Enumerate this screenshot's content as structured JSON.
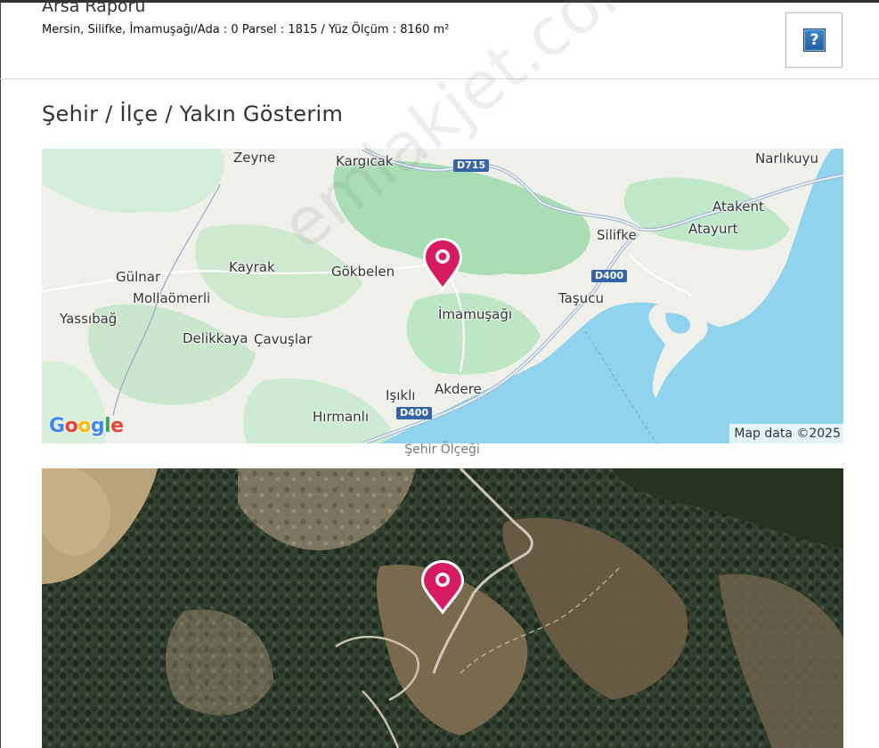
{
  "header": {
    "title": "Arsa Raporu",
    "subtitle": "Mersin, Silifke, İmamuşağı/Ada : 0 Parsel : 1815 / Yüz Ölçüm : 8160 m²",
    "help_label": "?"
  },
  "section": {
    "title": "Şehir / İlçe / Yakın Gösterim"
  },
  "road_map": {
    "places": {
      "zeyne": "Zeyne",
      "kargicak": "Kargıcak",
      "narlikuyu": "Narlıkuyu",
      "atakent": "Atakent",
      "atayurt": "Atayurt",
      "silifke": "Silifke",
      "gulnar": "Gülnar",
      "kayrak": "Kayrak",
      "gokbelen": "Gökbelen",
      "mollaomerli": "Mollaömerli",
      "yassibag": "Yassıbağ",
      "imamusagi": "İmamuşağı",
      "tasucu": "Taşucu",
      "delikkaya": "Delikkaya",
      "cavuslar": "Çavuşlar",
      "akdere": "Akdere",
      "isikli": "Işıklı",
      "hirmanli": "Hırmanlı"
    },
    "shields": {
      "d715": "D715",
      "d400_east": "D400",
      "d400_south": "D400"
    },
    "attribution": "Map data ©2025",
    "colors": {
      "water": "#8fd3ee",
      "land": "#eef0e9",
      "forest": "#b7e4c0",
      "marker": "#d81b60"
    }
  },
  "google_logo": {
    "g1": "G",
    "o1": "o",
    "o2": "o",
    "g2": "g",
    "l": "l",
    "e": "e"
  },
  "scale_caption": "Şehir Ölçeği",
  "watermark": "emlakjet.com"
}
